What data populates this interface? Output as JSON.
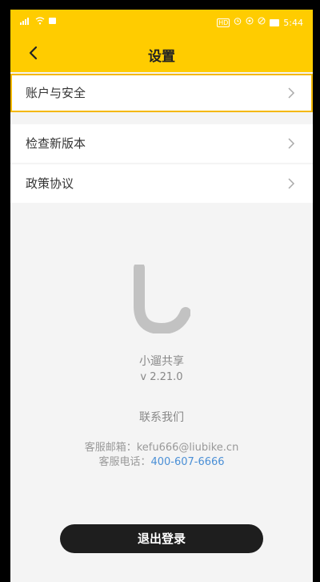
{
  "statusbar": {
    "left_icons": [
      "signal-icon",
      "wifi-icon",
      "notification-icon"
    ],
    "right_icons": [
      "hd-icon",
      "alarm-icon",
      "location-icon",
      "silent-icon",
      "battery-icon"
    ],
    "time": "5:44",
    "hd": "HD"
  },
  "header": {
    "title": "设置",
    "back_icon": "chevron-left-icon",
    "background": "#ffcc00"
  },
  "menu": {
    "items": [
      {
        "label": "账户与安全",
        "icon": "chevron-right-icon"
      },
      {
        "label": "检查新版本",
        "icon": "chevron-right-icon"
      },
      {
        "label": "政策协议",
        "icon": "chevron-right-icon"
      }
    ]
  },
  "about": {
    "logo_icon": "liubike-logo-icon",
    "app_name": "小遛共享",
    "version": "v 2.21.0",
    "contact_title": "联系我们",
    "email_label": "客服邮箱：",
    "email": "kefu666@liubike.cn",
    "phone_label": "客服电话：",
    "phone": "400-607-6666",
    "link_color": "#4a8fd6"
  },
  "logout": {
    "label": "退出登录",
    "background": "#1e1e1e"
  }
}
